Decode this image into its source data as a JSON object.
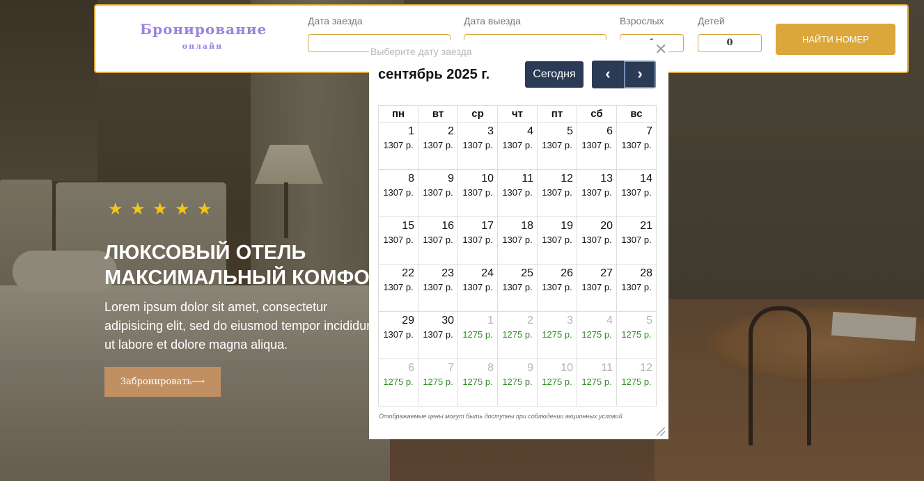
{
  "booking": {
    "logo_title": "Бронирование",
    "logo_sub": "онлайн",
    "checkin_label": "Дата заезда",
    "checkin_value": "",
    "checkout_label": "Дата выезда",
    "checkout_value": "",
    "adults_label": "Взрослых",
    "adults_value": "1",
    "children_label": "Детей",
    "children_value": "0",
    "search_button": "НАЙТИ НОМЕР"
  },
  "hero": {
    "star_count": 5,
    "title_line1": "ЛЮКСОВЫЙ ОТЕЛЬ",
    "title_line2": "МАКСИМАЛЬНЫЙ КОМФОРТ",
    "text_line1": "Lorem ipsum dolor sit amet, consectetur",
    "text_line2": "adipisicing elit, sed do eiusmod tempor incididunt",
    "text_line3": "ut labore et dolore magna aliqua.",
    "book_button": "Забронировать⟶"
  },
  "calendar": {
    "hint": "Выберите дату заезда",
    "close_symbol": "✕",
    "month_title": "сентябрь 2025 г.",
    "today_button": "Сегодня",
    "prev_symbol": "‹",
    "next_symbol": "›",
    "weekdays": [
      "пн",
      "вт",
      "ср",
      "чт",
      "пт",
      "сб",
      "вс"
    ],
    "weeks": [
      [
        {
          "day": "1",
          "price": "1307 р.",
          "other": false
        },
        {
          "day": "2",
          "price": "1307 р.",
          "other": false
        },
        {
          "day": "3",
          "price": "1307 р.",
          "other": false
        },
        {
          "day": "4",
          "price": "1307 р.",
          "other": false
        },
        {
          "day": "5",
          "price": "1307 р.",
          "other": false
        },
        {
          "day": "6",
          "price": "1307 р.",
          "other": false
        },
        {
          "day": "7",
          "price": "1307 р.",
          "other": false
        }
      ],
      [
        {
          "day": "8",
          "price": "1307 р.",
          "other": false
        },
        {
          "day": "9",
          "price": "1307 р.",
          "other": false
        },
        {
          "day": "10",
          "price": "1307 р.",
          "other": false
        },
        {
          "day": "11",
          "price": "1307 р.",
          "other": false
        },
        {
          "day": "12",
          "price": "1307 р.",
          "other": false
        },
        {
          "day": "13",
          "price": "1307 р.",
          "other": false
        },
        {
          "day": "14",
          "price": "1307 р.",
          "other": false
        }
      ],
      [
        {
          "day": "15",
          "price": "1307 р.",
          "other": false
        },
        {
          "day": "16",
          "price": "1307 р.",
          "other": false
        },
        {
          "day": "17",
          "price": "1307 р.",
          "other": false
        },
        {
          "day": "18",
          "price": "1307 р.",
          "other": false
        },
        {
          "day": "19",
          "price": "1307 р.",
          "other": false
        },
        {
          "day": "20",
          "price": "1307 р.",
          "other": false
        },
        {
          "day": "21",
          "price": "1307 р.",
          "other": false
        }
      ],
      [
        {
          "day": "22",
          "price": "1307 р.",
          "other": false
        },
        {
          "day": "23",
          "price": "1307 р.",
          "other": false
        },
        {
          "day": "24",
          "price": "1307 р.",
          "other": false
        },
        {
          "day": "25",
          "price": "1307 р.",
          "other": false
        },
        {
          "day": "26",
          "price": "1307 р.",
          "other": false
        },
        {
          "day": "27",
          "price": "1307 р.",
          "other": false
        },
        {
          "day": "28",
          "price": "1307 р.",
          "other": false
        }
      ],
      [
        {
          "day": "29",
          "price": "1307 р.",
          "other": false
        },
        {
          "day": "30",
          "price": "1307 р.",
          "other": false
        },
        {
          "day": "1",
          "price": "1275 р.",
          "other": true
        },
        {
          "day": "2",
          "price": "1275 р.",
          "other": true
        },
        {
          "day": "3",
          "price": "1275 р.",
          "other": true
        },
        {
          "day": "4",
          "price": "1275 р.",
          "other": true
        },
        {
          "day": "5",
          "price": "1275 р.",
          "other": true
        }
      ],
      [
        {
          "day": "6",
          "price": "1275 р.",
          "other": true
        },
        {
          "day": "7",
          "price": "1275 р.",
          "other": true
        },
        {
          "day": "8",
          "price": "1275 р.",
          "other": true
        },
        {
          "day": "9",
          "price": "1275 р.",
          "other": true
        },
        {
          "day": "10",
          "price": "1275 р.",
          "other": true
        },
        {
          "day": "11",
          "price": "1275 р.",
          "other": true
        },
        {
          "day": "12",
          "price": "1275 р.",
          "other": true
        }
      ]
    ],
    "note": "Отображаемые цены могут быть доступны при соблюдении акционных условий"
  },
  "colors": {
    "accent": "#dba63a",
    "logo": "#9b82e0",
    "navy": "#2b3a55",
    "book_button": "#c09063",
    "star": "#f3c614",
    "next_month_price": "#2e8b22"
  }
}
